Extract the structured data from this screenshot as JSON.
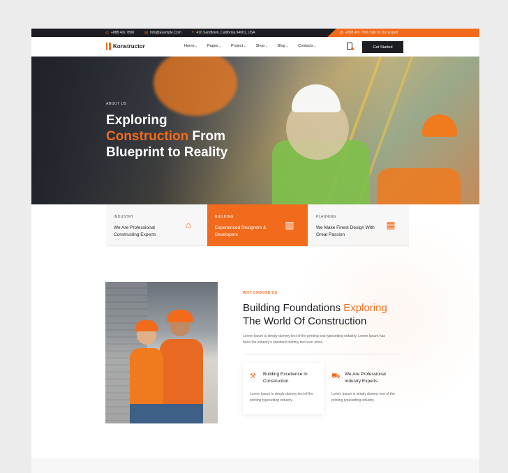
{
  "topbar": {
    "phone": "+888 40s 7890",
    "email": "Info@Example.Com",
    "address": "410 Sandtown, California 94001, USA",
    "expert": "+888 40s 7890 Talk To Our Expert"
  },
  "nav": {
    "logo": "Konstructor",
    "menu": [
      {
        "label": "Home"
      },
      {
        "label": "Pages"
      },
      {
        "label": "Project"
      },
      {
        "label": "Shop"
      },
      {
        "label": "Blog"
      },
      {
        "label": "Contacts"
      }
    ],
    "cta": "Get Started"
  },
  "hero": {
    "eyebrow": "ABOUT US",
    "title_1": "Exploring",
    "title_accent": "Construction",
    "title_2": " From",
    "title_3": "Blueprint to Reality"
  },
  "cards": [
    {
      "tag": "INDUSTRY",
      "text": "We Are Professional Constructing Experts",
      "icon": "house-tool-icon"
    },
    {
      "tag": "BUILDING",
      "text": "Experienced Designers & Developers",
      "icon": "factory-icon"
    },
    {
      "tag": "PLANNING",
      "text": "We Make Finest Design With Great Passion",
      "icon": "building-icon"
    }
  ],
  "why": {
    "tag": "WHY CHOOSE US",
    "title_1": "Building Foundations ",
    "title_accent": "Exploring",
    "title_2": "The World Of Construction",
    "desc": "Lorem Ipsum is simply dummy text of the printing and typesetting industry. Lorem Ipsum has been the industry's standard dummy text ever since.",
    "features": [
      {
        "title": "Building Excellence In Construction",
        "desc": "Lorem Ipsum is simply dummy text of the printing typesetting industry.",
        "icon": "crane-icon"
      },
      {
        "title": "We Are Professional Industry Experts",
        "desc": "Lorem Ipsum is simply dummy text of the printing typesetting industry.",
        "icon": "truck-icon"
      }
    ]
  },
  "colors": {
    "accent": "#f26b1d",
    "dark": "#1b1d22"
  }
}
